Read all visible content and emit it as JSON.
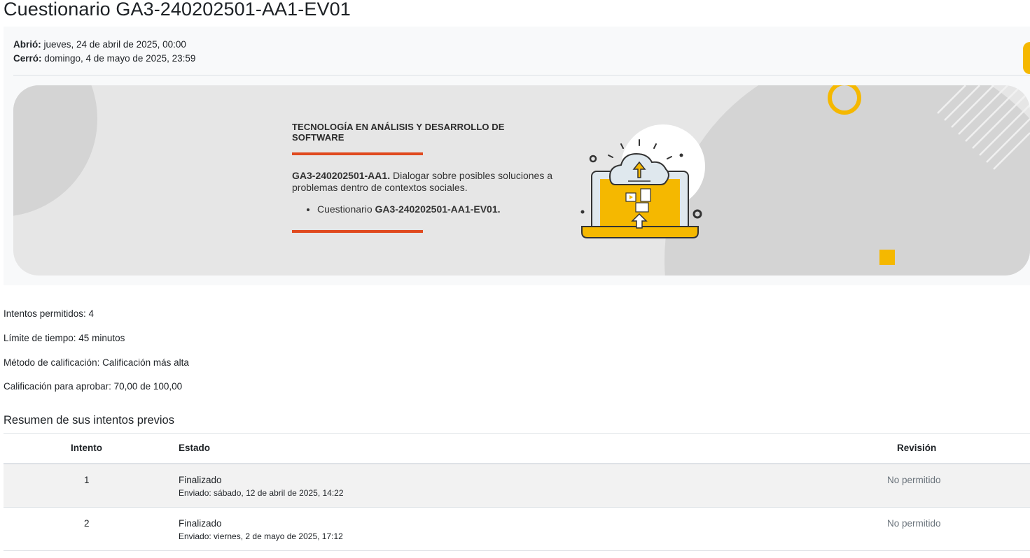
{
  "page": {
    "title": "Cuestionario GA3-240202501-AA1-EV01"
  },
  "dates": {
    "opened_label": "Abrió:",
    "opened_value": " jueves, 24 de abril de 2025, 00:00",
    "closed_label": "Cerró:",
    "closed_value": " domingo, 4 de mayo de 2025, 23:59"
  },
  "banner": {
    "heading": "TECNOLOGÍA EN ANÁLISIS Y DESARROLLO DE SOFTWARE",
    "activity_code": "GA3-240202501-AA1.",
    "activity_desc": " Dialogar sobre posibles soluciones a problemas dentro de contextos sociales.",
    "list_prefix": "Cuestionario ",
    "list_item_code": "GA3-240202501-AA1-EV01.",
    "accent_color": "#f5b800",
    "bar_color": "#e04a1f"
  },
  "quiz_info": {
    "attempts": "Intentos permitidos: 4",
    "time_limit": "Límite de tiempo: 45 minutos",
    "grading_method": "Método de calificación: Calificación más alta",
    "pass_grade": "Calificación para aprobar: 70,00 de 100,00"
  },
  "summary": {
    "title": "Resumen de sus intentos previos",
    "columns": [
      "Intento",
      "Estado",
      "Revisión"
    ],
    "rows": [
      {
        "attempt": "1",
        "state": "Finalizado",
        "submitted": "Enviado: sábado, 12 de abril de 2025, 14:22",
        "review": "No permitido"
      },
      {
        "attempt": "2",
        "state": "Finalizado",
        "submitted": "Enviado: viernes, 2 de mayo de 2025, 17:12",
        "review": "No permitido"
      }
    ]
  }
}
